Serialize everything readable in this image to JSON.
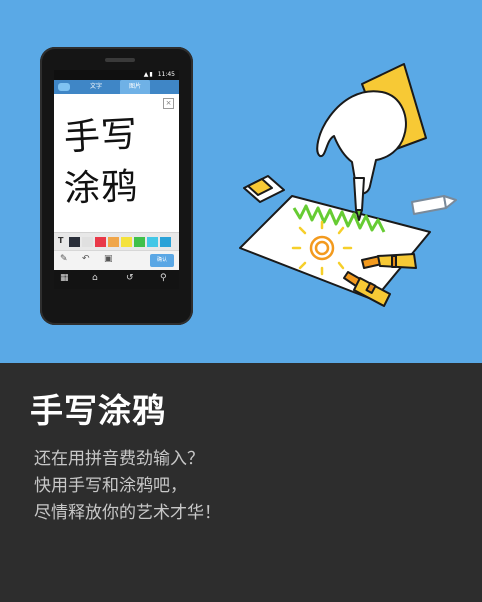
{
  "colors": {
    "hero_background": "#5aa9e6",
    "footer_background": "#2d2d2d",
    "title_color": "#ffffff",
    "text_color": "#c7c7c7",
    "app_accent": "#3f86c6"
  },
  "phone": {
    "status_time": "11:45",
    "tabs": [
      {
        "label": "文字",
        "selected": false
      },
      {
        "label": "图片",
        "selected": true
      }
    ],
    "handwriting": {
      "line1": "手写",
      "line2": "涂鸦"
    },
    "palette": {
      "text_tool": "T",
      "colors": [
        "#2a2f3a",
        "#e0e0e0",
        "#e93848",
        "#f0a64a",
        "#f4e23c",
        "#40c04a",
        "#43c7e6",
        "#2aa2d8"
      ]
    },
    "tools": {
      "pen_icon": "pencil-icon",
      "undo_icon": "undo-icon",
      "image_icon": "image-icon",
      "confirm_label": "确认"
    },
    "nav_icons": [
      "menu-icon",
      "home-icon",
      "back-icon",
      "search-icon"
    ]
  },
  "feature": {
    "title": "手写涂鸦",
    "description": [
      "还在用拼音费劲输入？",
      "快用手写和涂鸦吧，",
      "尽情释放你的艺术才华！"
    ]
  }
}
